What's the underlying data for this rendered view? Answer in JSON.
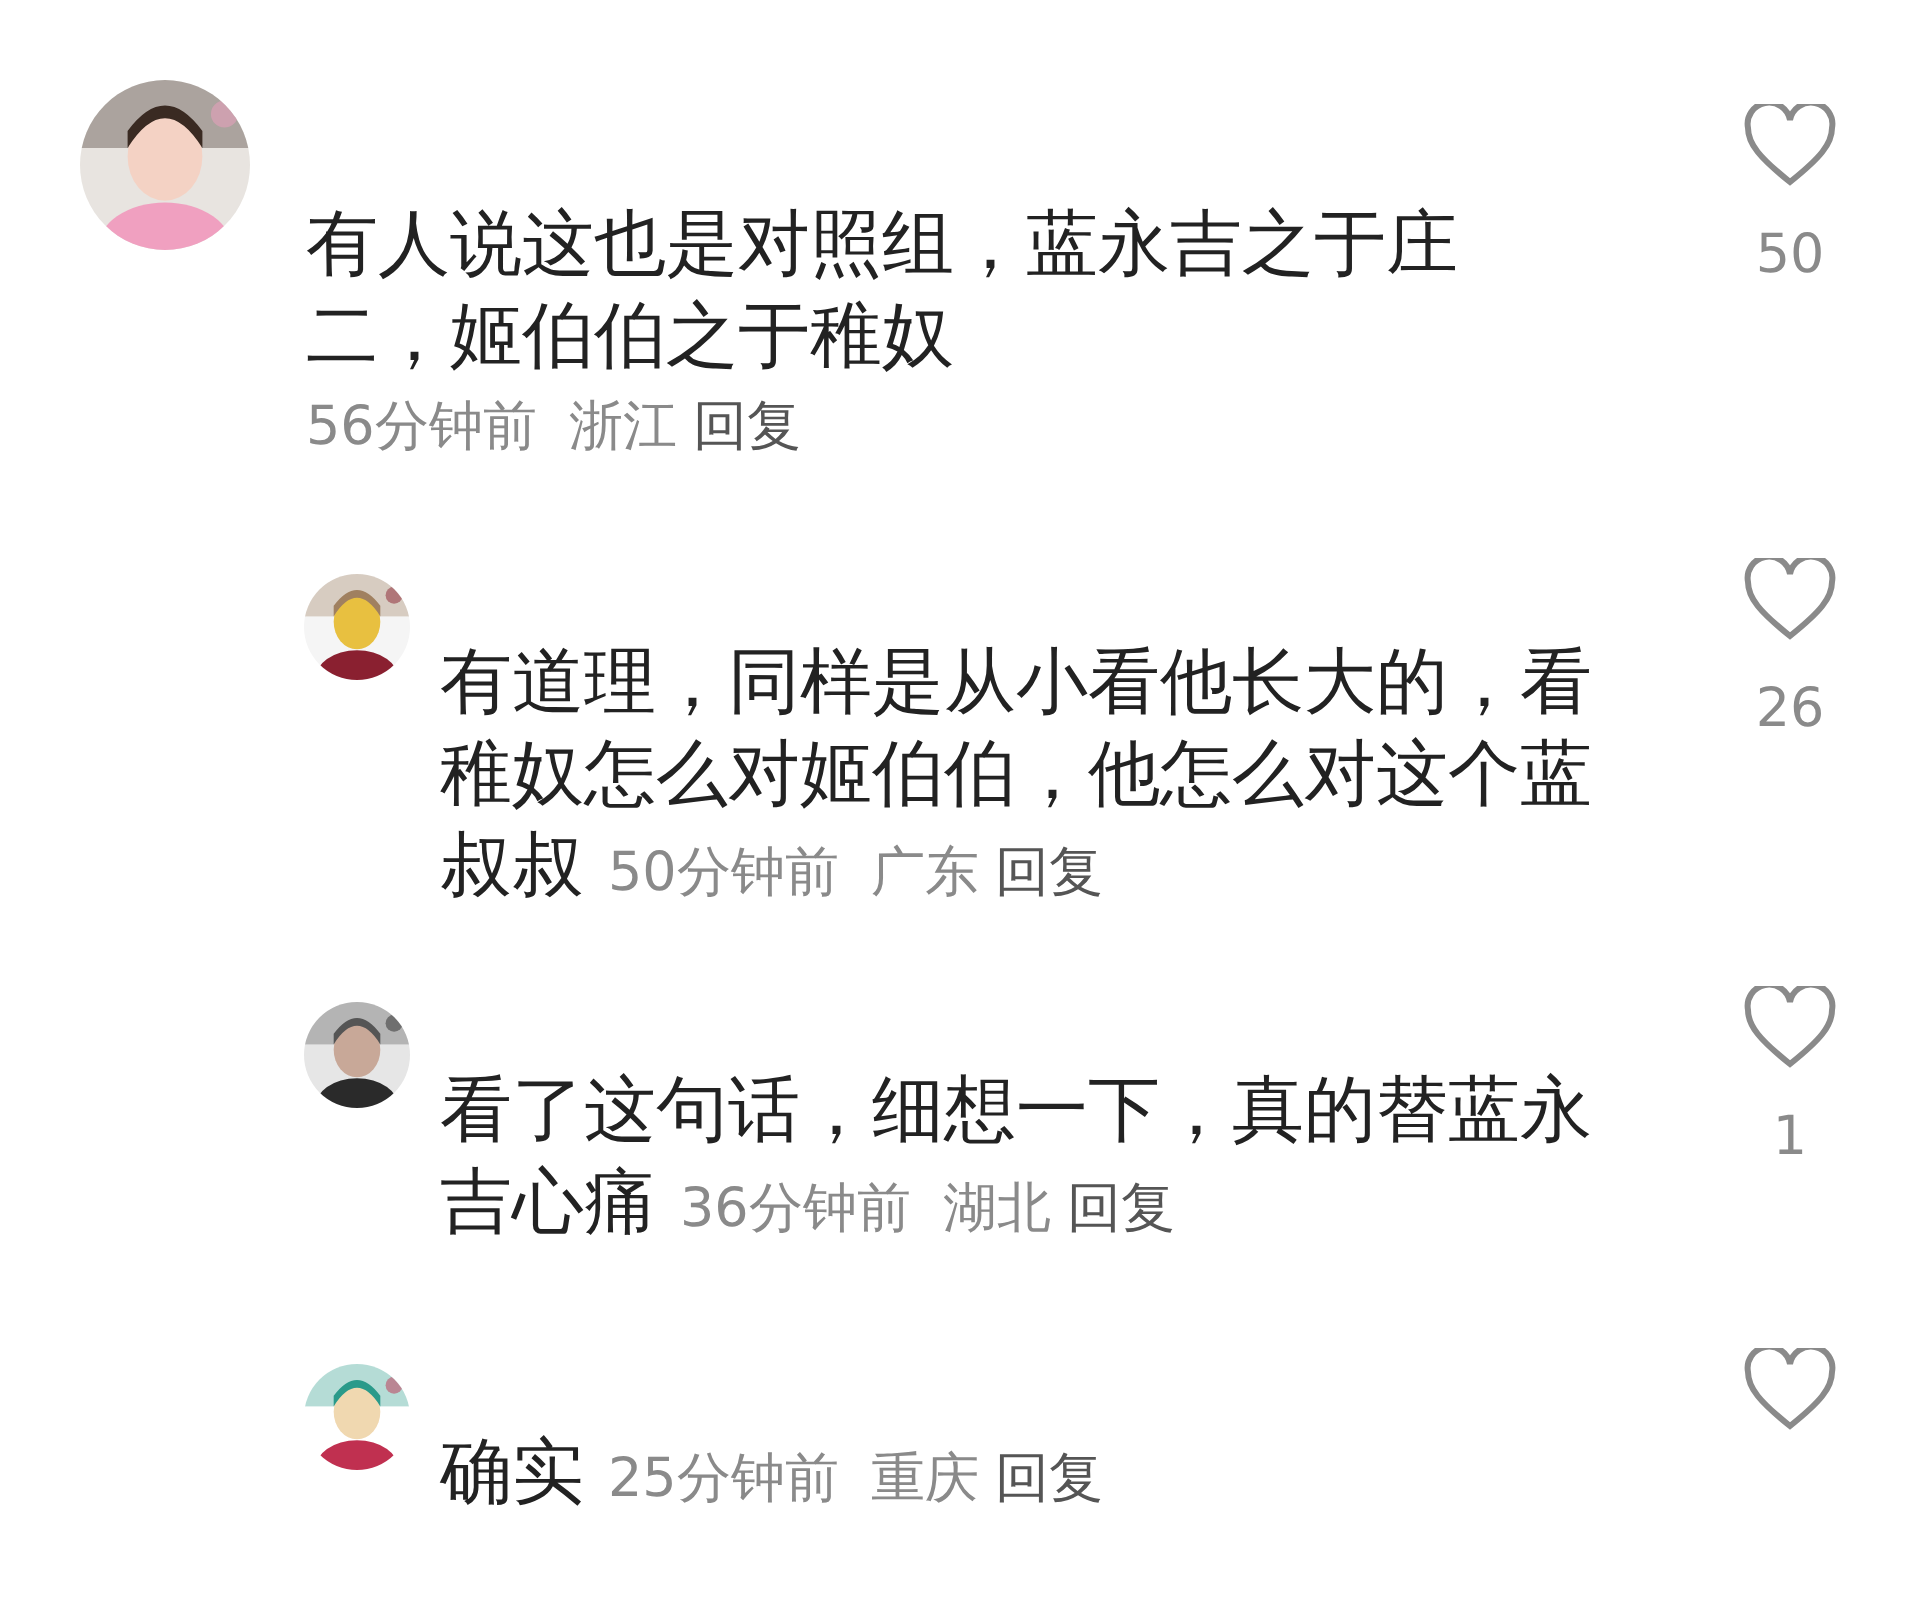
{
  "comments": [
    {
      "kind": "comment",
      "avatar": {
        "kind": "picture"
      },
      "text_lines": [
        "有人说这也是对照组，蓝永吉之于庄",
        "二，姬伯伯之于稚奴"
      ],
      "time": "56分钟前",
      "location": "浙江",
      "reply": "回复",
      "likes": "50",
      "liked": false
    },
    {
      "kind": "reply",
      "avatar": {
        "kind": "picture"
      },
      "text_lines": [
        "有道理，同样是从小看他长大的，看",
        "稚奴怎么对姬伯伯，他怎么对这个蓝",
        "叔叔"
      ],
      "time": "50分钟前",
      "location": "广东",
      "reply": "回复",
      "likes": "26",
      "liked": false
    },
    {
      "kind": "reply",
      "avatar": {
        "kind": "picture"
      },
      "text_lines": [
        "看了这句话，细想一下，真的替蓝永",
        "吉心痛"
      ],
      "time": "36分钟前",
      "location": "湖北",
      "reply": "回复",
      "likes": "1",
      "liked": false
    },
    {
      "kind": "reply",
      "avatar": {
        "kind": "picture"
      },
      "text_lines": [
        "确实"
      ],
      "time": "25分钟前",
      "location": "重庆",
      "reply": "回复",
      "liked": false
    }
  ]
}
